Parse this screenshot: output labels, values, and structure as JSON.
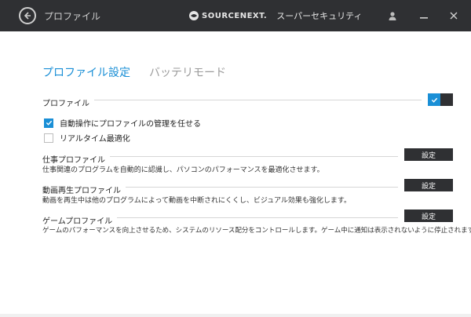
{
  "titlebar": {
    "title": "プロファイル",
    "brand_name": "SOURCENEXT.",
    "product_name": "スーパーセキュリティ"
  },
  "tabs": [
    {
      "label": "プロファイル設定",
      "active": true
    },
    {
      "label": "バッテリモード",
      "active": false
    }
  ],
  "profile_section": {
    "label": "プロファイル",
    "toggle_on": true
  },
  "options": [
    {
      "label": "自動操作にプロファイルの管理を任せる",
      "checked": true
    },
    {
      "label": "リアルタイム最適化",
      "checked": false
    }
  ],
  "profiles": [
    {
      "name": "仕事プロファイル",
      "description": "仕事関連のプログラムを自動的に認識し、パソコンのパフォーマンスを最適化させます。",
      "button": "設定"
    },
    {
      "name": "動画再生プロファイル",
      "description": "動画を再生中は他のプログラムによって動画を中断されにくくし、ビジュアル効果も強化します。",
      "button": "設定"
    },
    {
      "name": "ゲームプロファイル",
      "description": "ゲームのパフォーマンスを向上させるため、システムのリソース配分をコントロールします。ゲーム中に通知は表示されないように停止されます。",
      "button": "設定"
    }
  ],
  "colors": {
    "accent": "#1a8fd6",
    "titlebar": "#2f3033"
  }
}
